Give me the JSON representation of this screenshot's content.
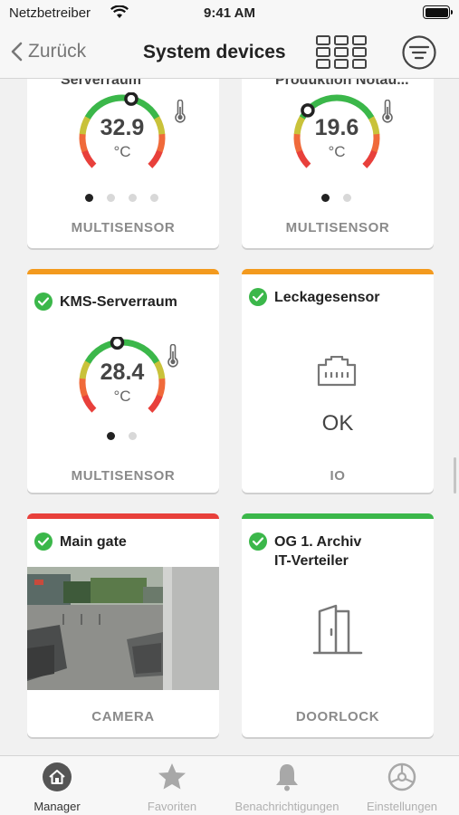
{
  "status_bar": {
    "carrier": "Netzbetreiber",
    "time": "9:41 AM",
    "battery_fraction": 1.0
  },
  "nav": {
    "back_label": "Zurück",
    "title": "System devices",
    "grid_icon": "grid-view-icon",
    "filter_icon": "filter-icon"
  },
  "cards": [
    {
      "title": "Serverraum",
      "value": "32.9",
      "unit": "°C",
      "type": "MULTISENSOR",
      "dots": 4,
      "active_dot": 1,
      "icon": "thermometer-icon"
    },
    {
      "title": "Produktion Notau...",
      "value": "19.6",
      "unit": "°C",
      "type": "MULTISENSOR",
      "dots": 2,
      "active_dot": 1,
      "icon": "thermometer-icon"
    },
    {
      "title": "KMS-Serverraum",
      "value": "28.4",
      "unit": "°C",
      "type": "MULTISENSOR",
      "dots": 2,
      "active_dot": 1,
      "accent": "#f39a1e",
      "icon": "thermometer-icon"
    },
    {
      "title": "Leckagesensor",
      "status": "OK",
      "type": "IO",
      "accent": "#f39a1e",
      "icon": "ethernet-port-icon"
    },
    {
      "title": "Main gate",
      "type": "CAMERA",
      "accent": "#e8403b",
      "icon": "camera-feed"
    },
    {
      "title_line1": "OG 1.  Archiv",
      "title_line2": "IT-Verteiler",
      "type": "DOORLOCK",
      "accent": "#3bb74a",
      "icon": "door-icon"
    }
  ],
  "tabs": [
    {
      "label": "Manager",
      "icon": "home-icon",
      "active": true
    },
    {
      "label": "Favoriten",
      "icon": "star-icon",
      "active": false
    },
    {
      "label": "Benachrichtigungen",
      "icon": "bell-icon",
      "active": false
    },
    {
      "label": "Einstellungen",
      "icon": "settings-wheel-icon",
      "active": false
    }
  ],
  "colors": {
    "gauge_green": "#3bb74a",
    "gauge_red": "#e8403b",
    "accent_orange": "#f39a1e"
  }
}
